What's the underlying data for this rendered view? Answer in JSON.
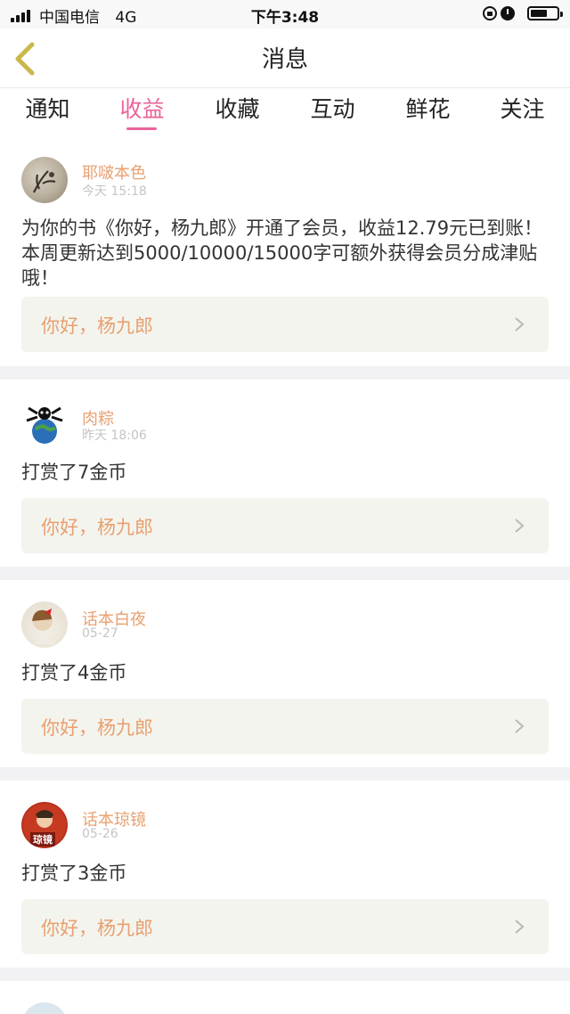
{
  "status_bar": {
    "carrier": "中国电信",
    "network": "4G",
    "time": "下午3:48",
    "battery_level": 0.65
  },
  "nav": {
    "title": "消息"
  },
  "tabs": {
    "items": [
      {
        "label": "通知"
      },
      {
        "label": "收益"
      },
      {
        "label": "收藏"
      },
      {
        "label": "互动"
      },
      {
        "label": "鲜花"
      },
      {
        "label": "关注"
      }
    ],
    "active": "收益"
  },
  "messages": [
    {
      "username": "耶啵本色",
      "time": "今天 15:18",
      "text": "为你的书《你好，杨九郎》开通了会员，收益12.79元已到账！本周更新达到5000/10000/15000字可额外获得会员分成津贴哦！",
      "book": "你好，杨九郎"
    },
    {
      "username": "肉粽",
      "time": "昨天 18:06",
      "text": "打赏了7金币",
      "book": "你好，杨九郎"
    },
    {
      "username": "话本白夜",
      "time": "05-27",
      "text": "打赏了4金币",
      "book": "你好，杨九郎"
    },
    {
      "username": "话本琼镜",
      "time": "05-26",
      "text": "打赏了3金币",
      "book": "你好，杨九郎",
      "avatar_text": "琼镜"
    }
  ],
  "colors": {
    "accent": "#e8639b",
    "username": "#e8a070",
    "back_arrow": "#c9b84a",
    "link_bg": "#f4f4ee"
  }
}
